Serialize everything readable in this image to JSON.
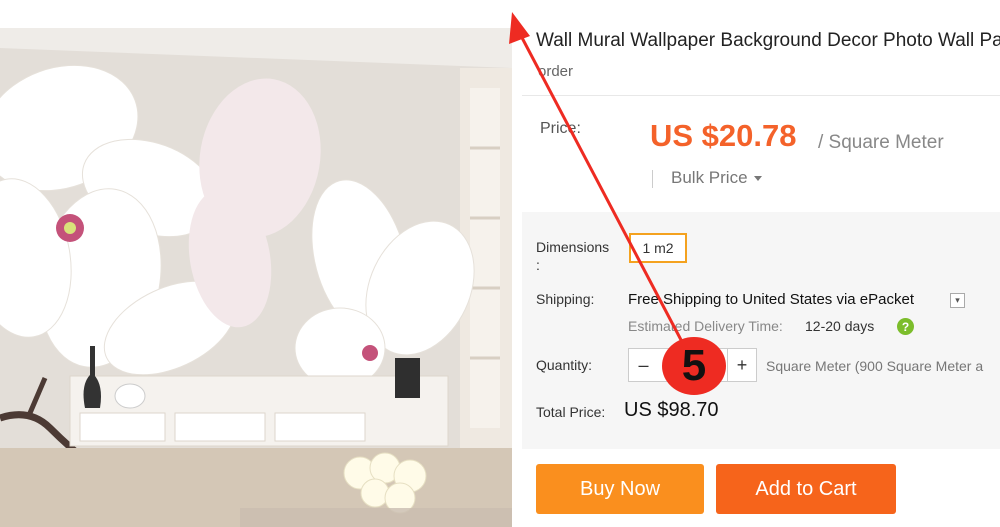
{
  "product": {
    "title": "Wall Mural Wallpaper Background Decor Photo Wall Pa",
    "order_count": "order"
  },
  "price": {
    "label": "Price:",
    "value": "US $20.78",
    "unit": "/ Square Meter",
    "bulk_label": "Bulk Price"
  },
  "dimensions": {
    "label": "Dimensions\n:",
    "selected": "1 m2"
  },
  "shipping": {
    "label": "Shipping:",
    "text": "Free Shipping to United States via ePacket",
    "delivery_label": "Estimated Delivery Time:",
    "delivery_value": "12-20 days",
    "help_icon": "?"
  },
  "quantity": {
    "label": "Quantity:",
    "minus": "–",
    "plus": "+",
    "value": "",
    "unit_text": "Square Meter (900 Square Meter a"
  },
  "total": {
    "label": "Total Price:",
    "value": "US $98.70"
  },
  "buttons": {
    "buy_now": "Buy Now",
    "add_to_cart": "Add to Cart"
  },
  "annotation": {
    "step_number": "5",
    "color": "#ee2b22"
  },
  "icons": {
    "dropdown": "chevron-down-icon",
    "help": "question-icon",
    "bulk_caret": "caret-down-icon"
  },
  "colors": {
    "price": "#f4622a",
    "buy_now": "#fa8f1e",
    "add_to_cart": "#f6641b",
    "selected_option_border": "#f4a21f",
    "help_icon": "#7cbd2b"
  }
}
